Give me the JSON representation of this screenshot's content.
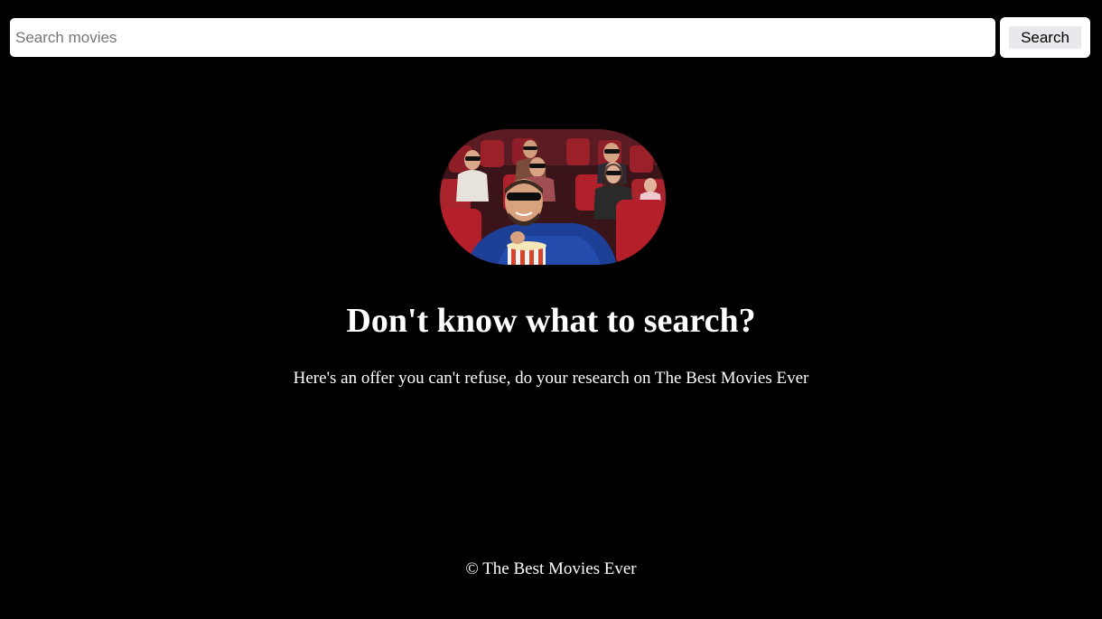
{
  "search": {
    "placeholder": "Search movies",
    "value": "",
    "button_label": "Search"
  },
  "hero": {
    "image": "cinema-audience-3d-glasses-photo",
    "headline": "Don't know what to search?",
    "tagline": "Here's an offer you can't refuse, do your research on The Best Movies Ever"
  },
  "footer": {
    "text": "© The Best Movies Ever"
  },
  "colors": {
    "background": "#000000",
    "text": "#ffffff",
    "input_background": "#ffffff",
    "button_background": "#e9e9ed",
    "seat_red": "#b0212b"
  }
}
